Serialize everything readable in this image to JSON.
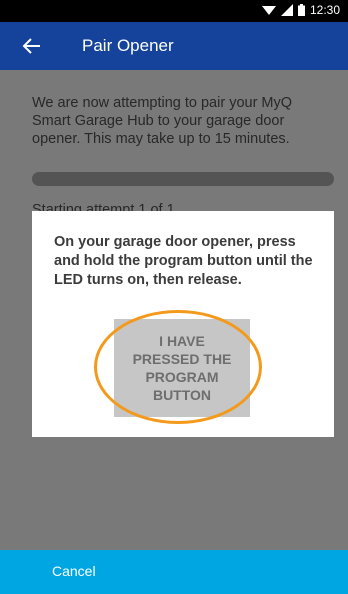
{
  "status_bar": {
    "time": "12:30"
  },
  "app_bar": {
    "title": "Pair Opener",
    "back_icon": "arrow-left-icon"
  },
  "main": {
    "intro": "We are now attempting to pair your MyQ Smart Garage Hub to your garage door opener. This may take up to 15 minutes.",
    "progress": 0,
    "attempt_status": "Starting attempt 1 of 1..."
  },
  "dialog": {
    "message": "On your garage door opener, press and hold the program button until the LED turns on, then release.",
    "confirm_label": "I HAVE PRESSED THE PROGRAM BUTTON"
  },
  "bottom_bar": {
    "cancel_label": "Cancel"
  },
  "colors": {
    "app_bar": "#15439b",
    "bottom_bar": "#00a6e2",
    "highlight": "#f39a1d"
  }
}
